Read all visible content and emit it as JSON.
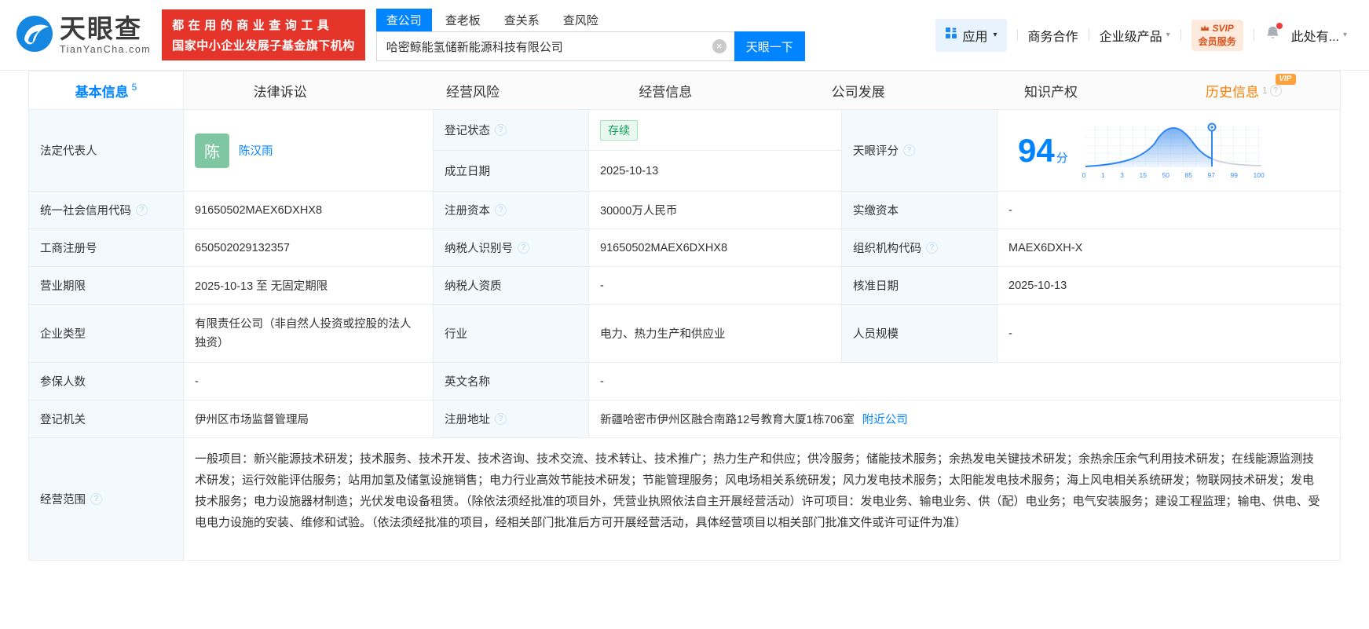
{
  "colors": {
    "accent": "#0084ff",
    "promo_red": "#e5342a",
    "vip_orange": "#ffa13a",
    "history_orange": "#ff7d00",
    "status_green": "#0e9e5b",
    "avatar_green": "#7ec7a2"
  },
  "icons": {
    "help": "?",
    "caret": "▾",
    "clear": "×"
  },
  "header": {
    "logo": {
      "brand": "天眼查",
      "domain": "TianYanCha.com"
    },
    "promo": {
      "line1": "都在用的商业查询工具",
      "line2": "国家中小企业发展子基金旗下机构"
    },
    "search": {
      "tabs": [
        "查公司",
        "查老板",
        "查关系",
        "查风险"
      ],
      "active_tab": "查公司",
      "value": "哈密鲸能氢储新能源科技有限公司",
      "button": "天眼一下"
    },
    "nav": {
      "apps": "应用",
      "cooperation": "商务合作",
      "enterprise": "企业级产品",
      "svip_top": "SVIP",
      "svip_bottom": "会员服务",
      "user": "此处有..."
    }
  },
  "tabs": [
    {
      "label": "基本信息",
      "badge": "5"
    },
    {
      "label": "法律诉讼"
    },
    {
      "label": "经营风险"
    },
    {
      "label": "经营信息"
    },
    {
      "label": "公司发展"
    },
    {
      "label": "知识产权"
    },
    {
      "label": "历史信息",
      "badge": "1",
      "vip": "VIP"
    }
  ],
  "table": {
    "legal_rep": {
      "label": "法定代表人",
      "avatar": "陈",
      "name": "陈汉雨"
    },
    "reg_status": {
      "label": "登记状态",
      "value": "存续"
    },
    "establish_date": {
      "label": "成立日期",
      "value": "2025-10-13"
    },
    "score": {
      "label": "天眼评分"
    },
    "credit_code": {
      "label": "统一社会信用代码",
      "value": "91650502MAEX6DXHX8"
    },
    "reg_capital": {
      "label": "注册资本",
      "value": "30000万人民币"
    },
    "paid_capital": {
      "label": "实缴资本",
      "value": "-"
    },
    "reg_number": {
      "label": "工商注册号",
      "value": "650502029132357"
    },
    "taxpayer_id": {
      "label": "纳税人识别号",
      "value": "91650502MAEX6DXHX8"
    },
    "org_code": {
      "label": "组织机构代码",
      "value": "MAEX6DXH-X"
    },
    "business_term": {
      "label": "营业期限",
      "value": "2025-10-13 至 无固定期限"
    },
    "taxpayer_quality": {
      "label": "纳税人资质",
      "value": "-"
    },
    "approval_date": {
      "label": "核准日期",
      "value": "2025-10-13"
    },
    "company_type": {
      "label": "企业类型",
      "value": "有限责任公司（非自然人投资或控股的法人独资）"
    },
    "industry": {
      "label": "行业",
      "value": "电力、热力生产和供应业"
    },
    "staff_size": {
      "label": "人员规模",
      "value": "-"
    },
    "insured_count": {
      "label": "参保人数",
      "value": "-"
    },
    "english_name": {
      "label": "英文名称",
      "value": "-"
    },
    "reg_authority": {
      "label": "登记机关",
      "value": "伊州区市场监督管理局"
    },
    "reg_address": {
      "label": "注册地址",
      "value": "新疆哈密市伊州区融合南路12号教育大厦1栋706室",
      "nearby_link": "附近公司"
    },
    "business_scope": {
      "label": "经营范围",
      "value": "一般项目：新兴能源技术研发；技术服务、技术开发、技术咨询、技术交流、技术转让、技术推广；热力生产和供应；供冷服务；储能技术服务；余热发电关键技术研发；余热余压余气利用技术研发；在线能源监测技术研发；运行效能评估服务；站用加氢及储氢设施销售；电力行业高效节能技术研发；节能管理服务；风电场相关系统研发；风力发电技术服务；太阳能发电技术服务；海上风电相关系统研发；物联网技术研发；发电技术服务；电力设施器材制造；光伏发电设备租赁。（除依法须经批准的项目外，凭营业执照依法自主开展经营活动）许可项目：发电业务、输电业务、供（配）电业务；电气安装服务；建设工程监理；输电、供电、受电电力设施的安装、维修和试验。（依法须经批准的项目，经相关部门批准后方可开展经营活动，具体经营项目以相关部门批准文件或许可证件为准）"
    }
  },
  "score_chart": {
    "type": "area",
    "title": "天眼评分",
    "score": "94",
    "unit": "分",
    "marker_value": 94,
    "ticks": [
      "0",
      "1",
      "3",
      "15",
      "50",
      "85",
      "97",
      "99",
      "100"
    ]
  }
}
